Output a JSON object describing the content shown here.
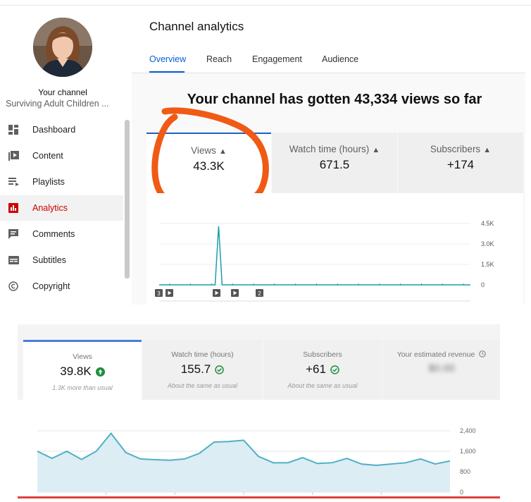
{
  "sidebar": {
    "your_channel": "Your channel",
    "channel_name": "Surviving Adult Children ...",
    "items": [
      {
        "label": "Dashboard",
        "icon": "dashboard-icon"
      },
      {
        "label": "Content",
        "icon": "content-icon"
      },
      {
        "label": "Playlists",
        "icon": "playlists-icon"
      },
      {
        "label": "Analytics",
        "icon": "analytics-icon",
        "active": true
      },
      {
        "label": "Comments",
        "icon": "comments-icon"
      },
      {
        "label": "Subtitles",
        "icon": "subtitles-icon"
      },
      {
        "label": "Copyright",
        "icon": "copyright-icon"
      }
    ]
  },
  "main": {
    "title": "Channel analytics",
    "tabs": [
      "Overview",
      "Reach",
      "Engagement",
      "Audience"
    ],
    "headline": "Your channel has gotten 43,334 views so far",
    "cards": [
      {
        "label": "Views",
        "value": "43.3K"
      },
      {
        "label": "Watch time (hours)",
        "value": "671.5"
      },
      {
        "label": "Subscribers",
        "value": "+174"
      }
    ],
    "markers": [
      "3",
      "2"
    ],
    "annotation_color": "#f05a14"
  },
  "bottom": {
    "cards": [
      {
        "label": "Views",
        "value": "39.8K",
        "note": "1.3K more than usual",
        "status": "up-arrow-icon"
      },
      {
        "label": "Watch time (hours)",
        "value": "155.7",
        "note": "About the same as usual",
        "status": "check-icon"
      },
      {
        "label": "Subscribers",
        "value": "+61",
        "note": "About the same as usual",
        "status": "check-icon"
      },
      {
        "label": "Your estimated revenue",
        "value": "$0.00",
        "note": "",
        "status": "clock-icon"
      }
    ]
  },
  "chart_data": [
    {
      "type": "line",
      "y_ticks": [
        "4.5K",
        "3.0K",
        "1.5K",
        "0"
      ],
      "ylim": [
        0,
        4500
      ],
      "values": [
        0,
        0,
        0,
        0,
        0,
        0,
        0,
        0,
        0,
        0,
        0,
        0,
        0,
        0,
        0,
        0,
        0,
        4300,
        0,
        0,
        0,
        0,
        0,
        0,
        0,
        0,
        0,
        0,
        0,
        0,
        0,
        0,
        0,
        0,
        0,
        0,
        0,
        0,
        0,
        0,
        0,
        0,
        0,
        0,
        0,
        0,
        0,
        0,
        0,
        0,
        0,
        0,
        0,
        0,
        0,
        0,
        0,
        0,
        0,
        0,
        0,
        0,
        0,
        0,
        0,
        0,
        0,
        0,
        0,
        0,
        0,
        0,
        0,
        0,
        0,
        0,
        0,
        0,
        0,
        0,
        0,
        0,
        0,
        0,
        0,
        0,
        0,
        0,
        0,
        0
      ],
      "color": "#1a9fa8"
    },
    {
      "type": "area",
      "y_ticks": [
        "2,400",
        "1,600",
        "800",
        "0"
      ],
      "ylim": [
        0,
        2400
      ],
      "values": [
        1600,
        1320,
        1600,
        1280,
        1600,
        2300,
        1550,
        1300,
        1270,
        1250,
        1300,
        1520,
        1960,
        1980,
        2030,
        1400,
        1150,
        1150,
        1350,
        1120,
        1150,
        1320,
        1100,
        1050,
        1100,
        1150,
        1300,
        1100,
        1220
      ],
      "color": "#4fb0c6"
    }
  ]
}
